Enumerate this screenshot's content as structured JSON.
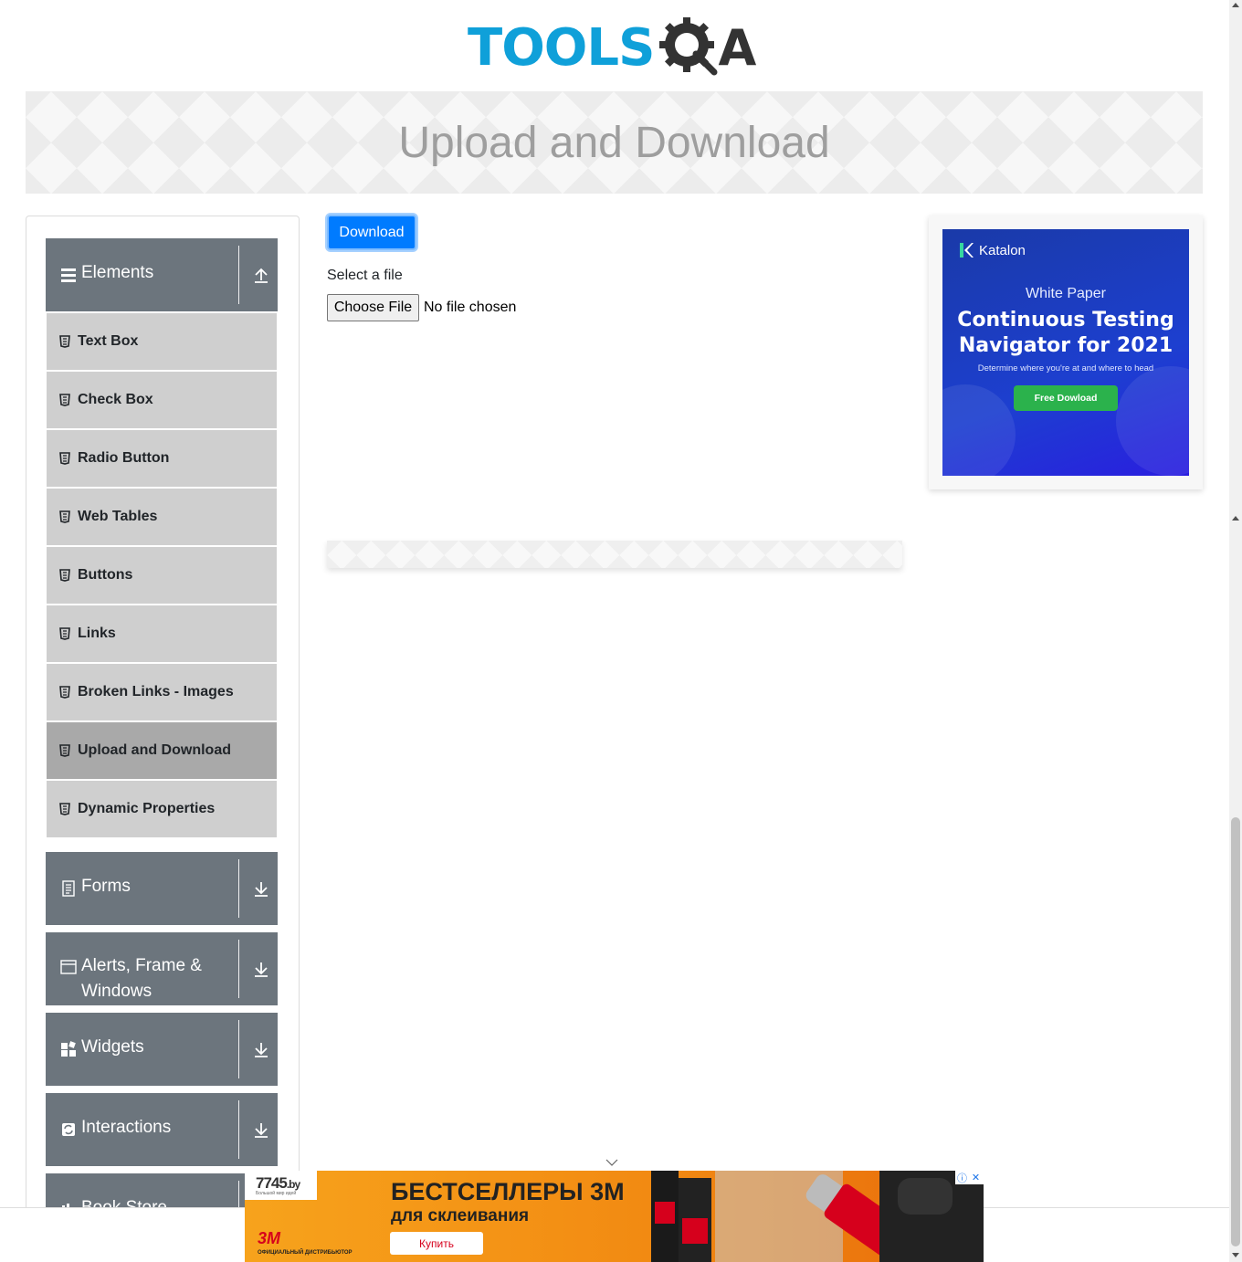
{
  "header": {
    "logo_text_left": "TOOLS",
    "logo_text_right": "A"
  },
  "banner": {
    "title": "Upload and Download"
  },
  "sidebar": {
    "groups": [
      {
        "label": "Elements",
        "icon": "hamburger-icon",
        "toggle": "upload-arrow-icon",
        "expanded": true
      },
      {
        "label": "Forms",
        "icon": "document-icon",
        "toggle": "download-arrow-icon"
      },
      {
        "label": "Alerts, Frame & Windows",
        "icon": "window-icon",
        "toggle": "download-arrow-icon"
      },
      {
        "label": "Widgets",
        "icon": "widgets-icon",
        "toggle": "download-arrow-icon"
      },
      {
        "label": "Interactions",
        "icon": "interactions-icon",
        "toggle": "download-arrow-icon"
      },
      {
        "label": "Book Store",
        "icon": "book-store-icon",
        "toggle": "download-arrow-icon"
      }
    ],
    "items": [
      {
        "label": "Text Box"
      },
      {
        "label": "Check Box"
      },
      {
        "label": "Radio Button"
      },
      {
        "label": "Web Tables"
      },
      {
        "label": "Buttons"
      },
      {
        "label": "Links"
      },
      {
        "label": "Broken Links - Images"
      },
      {
        "label": "Upload and Download",
        "active": true
      },
      {
        "label": "Dynamic Properties"
      }
    ]
  },
  "main": {
    "download_label": "Download",
    "select_label": "Select a file",
    "choose_file_label": "Choose File",
    "file_status": "No file chosen"
  },
  "right_ad": {
    "brand": "Katalon",
    "kicker": "White Paper",
    "title_line1": "Continuous Testing",
    "title_line2": "Navigator for 2021",
    "subtitle": "Determine where you're at and where to head",
    "cta": "Free Dowload"
  },
  "bottom_ad": {
    "logo": "7745",
    "logo_suffix": ".by",
    "logo_sub": "Большой мир идей",
    "headline": "БЕСТСЕЛЛЕРЫ 3М",
    "subline": "для склеивания",
    "brand": "3M",
    "distributor": "ОФИЦИАЛЬНЫЙ ДИСТРИБЬЮТОР",
    "cta": "Купить",
    "info_icon": "ⓘ",
    "close_icon": "✕"
  },
  "colors": {
    "brand_blue": "#0fa0d9",
    "sidebar_header": "#6c757d",
    "menu_item": "#cfcfcf",
    "menu_item_active": "#a9a9a9",
    "primary": "#007bff",
    "ad_orange": "#f28a12"
  }
}
